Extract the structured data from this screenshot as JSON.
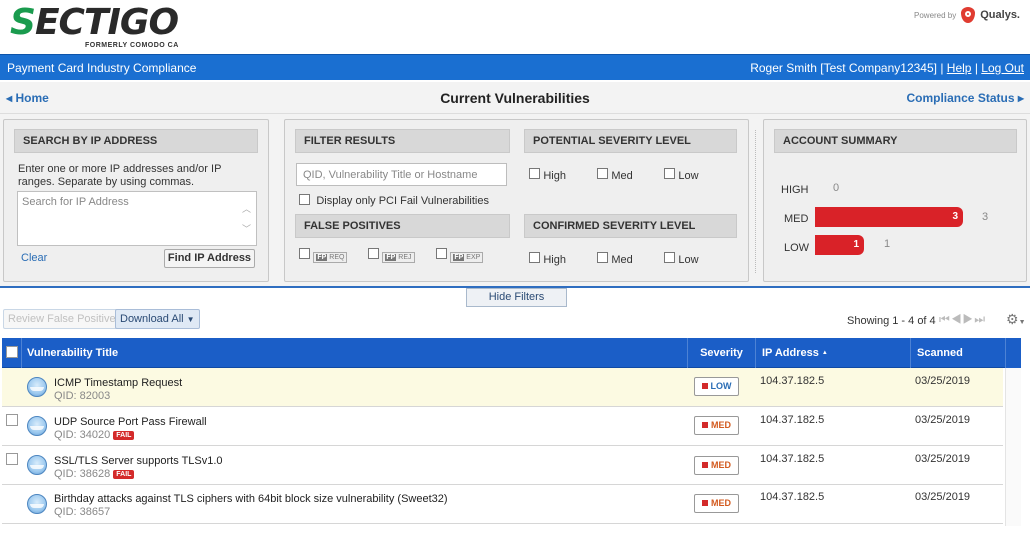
{
  "brand": {
    "logo_text": "SECTIGO",
    "logo_subtitle": "FORMERLY COMODO CA",
    "powered_by": "Powered by",
    "partner": "Qualys.",
    "colors": {
      "logo_green": "#1a9b4e",
      "app_bar": "#1a6fd1",
      "table_header": "#1b5ec7",
      "severity_bar": "#d92228"
    }
  },
  "app_bar": {
    "title": "Payment Card Industry Compliance",
    "user": "Roger Smith [Test Company12345]",
    "sep1": "|",
    "help": "Help",
    "sep2": "|",
    "logout": "Log Out"
  },
  "nav": {
    "home_icon": "triangle-left-icon",
    "home": "Home",
    "page_title": "Current Vulnerabilities",
    "compliance": "Compliance Status",
    "compliance_icon": "triangle-right-icon"
  },
  "search_ip": {
    "header": "SEARCH BY IP ADDRESS",
    "help": "Enter one or more IP addresses and/or IP ranges. Separate by using commas.",
    "placeholder": "Search for IP Address",
    "clear": "Clear",
    "find": "Find IP Address"
  },
  "filter_results": {
    "header": "FILTER RESULTS",
    "placeholder": "QID, Vulnerability Title or Hostname",
    "pci_only": "Display only PCI Fail Vulnerabilities"
  },
  "false_positives": {
    "header": "FALSE POSITIVES",
    "items": [
      {
        "badge": "FP",
        "label": "REQ"
      },
      {
        "badge": "FP",
        "label": "REJ"
      },
      {
        "badge": "FP",
        "label": "EXP"
      }
    ]
  },
  "potential_severity": {
    "header": "POTENTIAL SEVERITY LEVEL",
    "options": [
      "High",
      "Med",
      "Low"
    ]
  },
  "confirmed_severity": {
    "header": "CONFIRMED SEVERITY LEVEL",
    "options": [
      "High",
      "Med",
      "Low"
    ]
  },
  "account_summary": {
    "header": "ACCOUNT SUMMARY",
    "rows": [
      {
        "label": "HIGH",
        "value": 0,
        "bar_label": "",
        "count": "0"
      },
      {
        "label": "MED",
        "value": 3,
        "bar_label": "3",
        "count": "3"
      },
      {
        "label": "LOW",
        "value": 1,
        "bar_label": "1",
        "count": "1"
      }
    ],
    "scale_max": 3
  },
  "hide_filters": "Hide Filters",
  "toolbar": {
    "review_fp": "Review False Positives",
    "download": "Download All",
    "download_icon": "caret-down-icon",
    "showing": "Showing 1 - 4 of 4",
    "pager_icons": "first-prev-next-last-icons",
    "gear_icon": "gear-icon"
  },
  "table": {
    "columns": [
      "Vulnerability Title",
      "Severity",
      "IP Address",
      "Scanned"
    ],
    "sort_indicator": "▲",
    "rows": [
      {
        "title": "ICMP Timestamp Request",
        "qid": "QID: 82003",
        "fail": "",
        "severity": "LOW",
        "ip": "104.37.182.5",
        "scanned": "03/25/2019",
        "checkbox": false,
        "highlight": true
      },
      {
        "title": "UDP Source Port Pass Firewall",
        "qid": "QID: 34020",
        "fail": "FAIL",
        "severity": "MED",
        "ip": "104.37.182.5",
        "scanned": "03/25/2019",
        "checkbox": true,
        "highlight": false
      },
      {
        "title": "SSL/TLS Server supports TLSv1.0",
        "qid": "QID: 38628",
        "fail": "FAIL",
        "severity": "MED",
        "ip": "104.37.182.5",
        "scanned": "03/25/2019",
        "checkbox": true,
        "highlight": false
      },
      {
        "title": "Birthday attacks against TLS ciphers with 64bit block size vulnerability (Sweet32)",
        "qid": "QID: 38657",
        "fail": "",
        "severity": "MED",
        "ip": "104.37.182.5",
        "scanned": "03/25/2019",
        "checkbox": false,
        "highlight": false
      }
    ]
  }
}
